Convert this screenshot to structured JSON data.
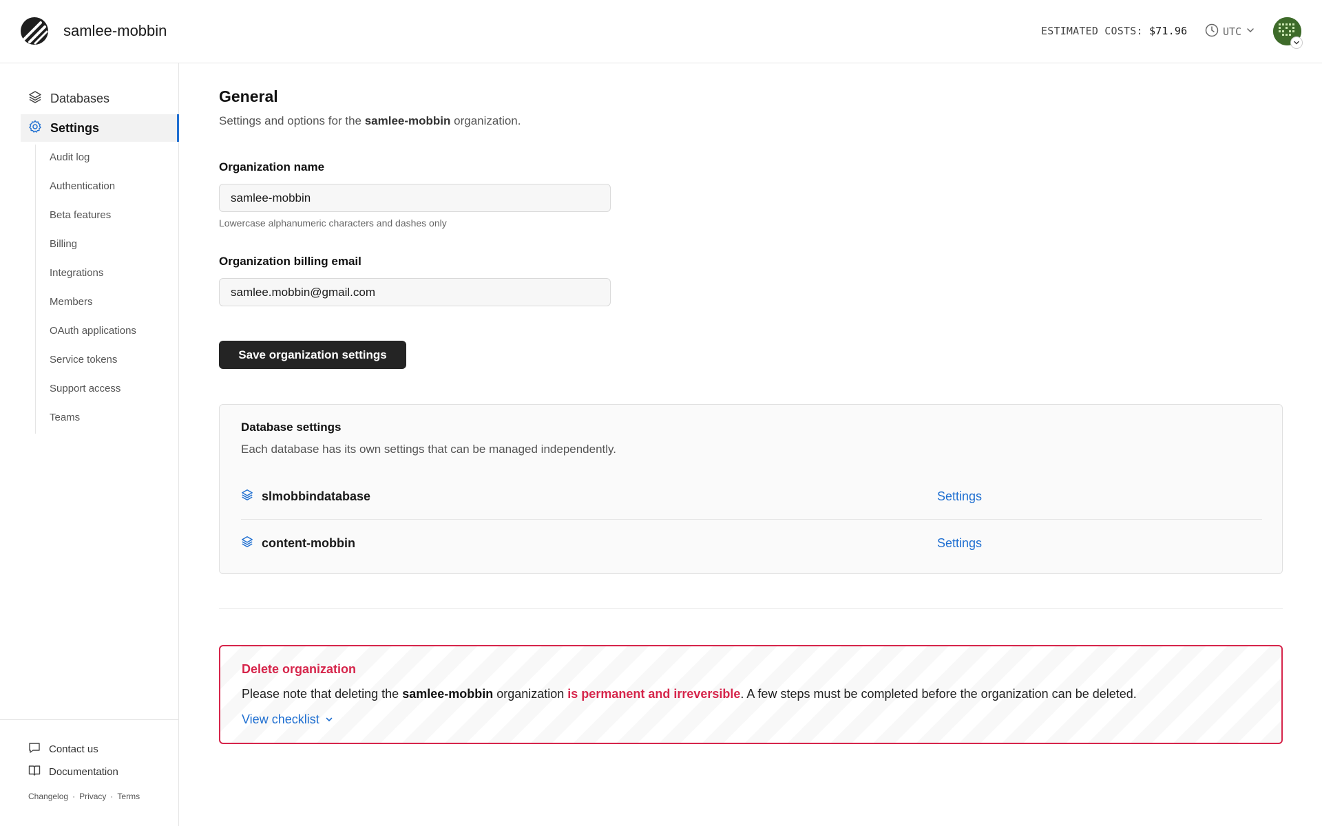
{
  "header": {
    "org_title": "samlee-mobbin",
    "costs_label": "ESTIMATED COSTS:",
    "costs_value": "$71.96",
    "timezone": "UTC"
  },
  "sidebar": {
    "items": [
      {
        "label": "Databases",
        "icon": "layers-icon"
      },
      {
        "label": "Settings",
        "icon": "gear-icon",
        "active": true
      }
    ],
    "sub_items": [
      "Audit log",
      "Authentication",
      "Beta features",
      "Billing",
      "Integrations",
      "Members",
      "OAuth applications",
      "Service tokens",
      "Support access",
      "Teams"
    ],
    "footer": {
      "contact": "Contact us",
      "documentation": "Documentation",
      "changelog": "Changelog",
      "privacy": "Privacy",
      "terms": "Terms",
      "separator": "·"
    }
  },
  "main": {
    "title": "General",
    "subtitle_pre": "Settings and options for the ",
    "subtitle_org": "samlee-mobbin",
    "subtitle_post": " organization.",
    "org_name_label": "Organization name",
    "org_name_value": "samlee-mobbin",
    "org_name_hint": "Lowercase alphanumeric characters and dashes only",
    "billing_email_label": "Organization billing email",
    "billing_email_value": "samlee.mobbin@gmail.com",
    "save_label": "Save organization settings"
  },
  "database_settings": {
    "title": "Database settings",
    "description": "Each database has its own settings that can be managed independently.",
    "databases": [
      {
        "name": "slmobbindatabase",
        "link": "Settings"
      },
      {
        "name": "content-mobbin",
        "link": "Settings"
      }
    ]
  },
  "danger_zone": {
    "title": "Delete organization",
    "text_pre": "Please note that deleting the ",
    "text_org": "samlee-mobbin",
    "text_mid": " organization ",
    "text_warn": "is permanent and irreversible",
    "text_post": ". A few steps must be completed before the organization can be deleted.",
    "checklist_label": "View checklist"
  },
  "colors": {
    "accent": "#1f6fd1",
    "danger": "#d6254b",
    "button_bg": "#242424"
  }
}
